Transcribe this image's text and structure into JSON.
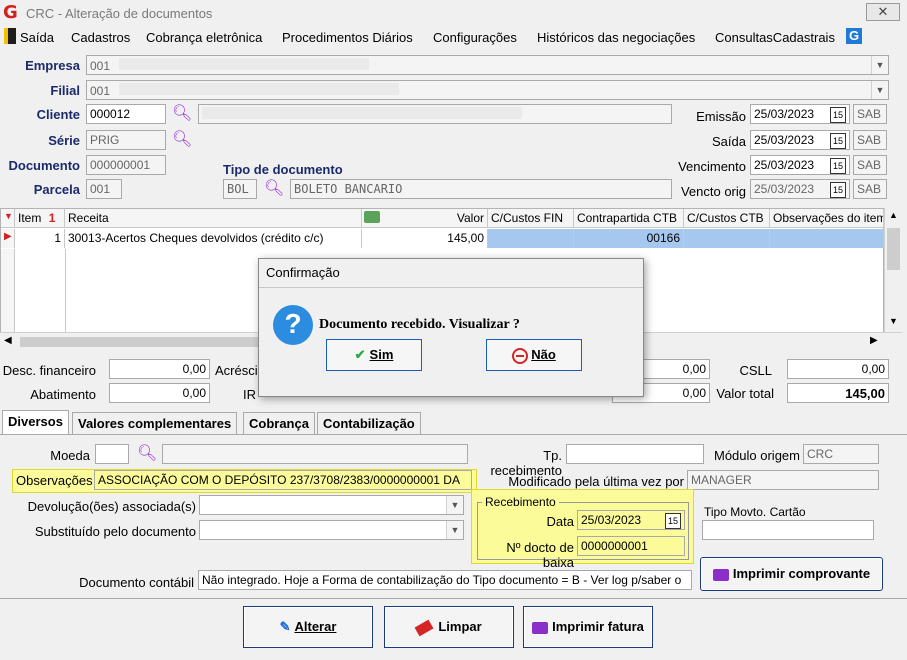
{
  "window": {
    "title": "CRC - Alteração de documentos",
    "close_label": "✕"
  },
  "menu": [
    "Saída",
    "Cadastros",
    "Cobrança eletrônica",
    "Procedimentos Diários",
    "Configurações",
    "Históricos das negociações",
    "ConsultasCadastrais"
  ],
  "header": {
    "empresa_label": "Empresa",
    "empresa_value": "001",
    "filial_label": "Filial",
    "filial_value": "001",
    "cliente_label": "Cliente",
    "cliente_value": "000012",
    "serie_label": "Série",
    "serie_value": "PRIG",
    "documento_label": "Documento",
    "documento_value": "000000001",
    "parcela_label": "Parcela",
    "parcela_value": "001",
    "tipo_doc_label": "Tipo de documento",
    "tipo_doc_code": "BOL",
    "tipo_doc_desc": "BOLETO BANCARIO",
    "emissao_label": "Emissão",
    "emissao_value": "25/03/2023",
    "emissao_day": "SAB",
    "saida_label": "Saída",
    "saida_value": "25/03/2023",
    "saida_day": "SAB",
    "vencimento_label": "Vencimento",
    "vencimento_value": "25/03/2023",
    "vencimento_day": "SAB",
    "vencto_orig_label": "Vencto orig",
    "vencto_orig_value": "25/03/2023",
    "vencto_orig_day": "SAB",
    "cal_label": "15"
  },
  "grid": {
    "headers": [
      "Item",
      "Receita",
      "Valor",
      "C/Custos FIN",
      "Contrapartida CTB",
      "C/Custos CTB",
      "Observações do item"
    ],
    "sort_icon": "1",
    "rows": [
      {
        "item": "1",
        "receita": "30013-Acertos Cheques devolvidos (crédito c/c)",
        "valor": "145,00",
        "ccfin": "",
        "contrapartida": "00166",
        "ccctb": "",
        "obs": ""
      }
    ]
  },
  "totals": {
    "desc_fin_label": "Desc. financeiro",
    "desc_fin_value": "0,00",
    "acrescimo_label": "Acréscimo",
    "abatimento_label": "Abatimento",
    "abatimento_value": "0,00",
    "ir_label": "IR",
    "col5_row1": "0,00",
    "col5_row2": "0,00",
    "csll_label": "CSLL",
    "csll_value": "0,00",
    "valor_total_label": "Valor total",
    "valor_total_value": "145,00"
  },
  "tabs": [
    "Diversos",
    "Valores complementares",
    "Cobrança",
    "Contabilização"
  ],
  "diversos": {
    "moeda_label": "Moeda",
    "moeda_value": "",
    "tp_receb_label": "Tp. recebimento",
    "tp_receb_value": "",
    "modulo_label": "Módulo origem",
    "modulo_value": "CRC",
    "obs_label": "Observações",
    "obs_value": "ASSOCIAÇÃO COM O DEPÓSITO 237/3708/2383/0000000001 DA",
    "modificado_label": "Modificado pela última vez por",
    "modificado_value": "MANAGER",
    "devolucao_label": "Devolução(ões) associada(s)",
    "substituido_label": "Substituído pelo documento",
    "recebimento_group": "Recebimento",
    "data_label": "Data",
    "data_value": "25/03/2023",
    "ndocto_label": "Nº docto de baixa",
    "ndocto_value": "0000000001",
    "tipo_movto_label": "Tipo Movto. Cartão",
    "imprimir_comprovante": "Imprimir comprovante",
    "doc_contabil_label": "Documento contábil",
    "doc_contabil_value": "Não integrado. Hoje a Forma de contabilização do Tipo documento = B - Ver log p/saber o"
  },
  "actions": {
    "alterar": "Alterar",
    "limpar": "Limpar",
    "imprimir_fatura": "Imprimir fatura"
  },
  "dialog": {
    "title": "Confirmação",
    "message": "Documento recebido. Visualizar ?",
    "yes": "Sim",
    "no": "Não"
  },
  "colors": {
    "title_logo": "#d41f1f",
    "label_blue": "#1a2a6c",
    "selection": "#a6c8ef",
    "highlight": "#fbfb9a",
    "search_icon": "#9a2fd6"
  }
}
